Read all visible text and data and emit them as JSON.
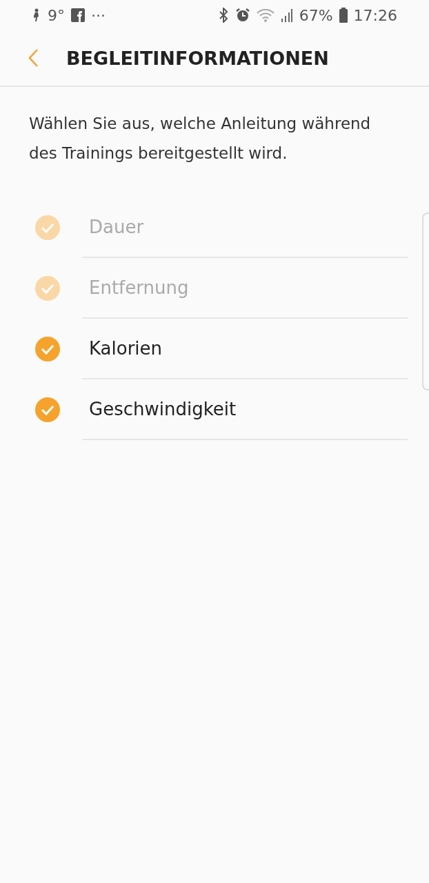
{
  "status_bar": {
    "temperature": "9°",
    "more": "···",
    "battery": "67%",
    "time": "17:26"
  },
  "header": {
    "title": "BEGLEITINFORMATIONEN"
  },
  "description": "Wählen Sie aus, welche Anleitung während des Trainings bereitgestellt wird.",
  "options": [
    {
      "label": "Dauer",
      "checked": true,
      "disabled": true
    },
    {
      "label": "Entfernung",
      "checked": true,
      "disabled": true
    },
    {
      "label": "Kalorien",
      "checked": true,
      "disabled": false
    },
    {
      "label": "Geschwindigkeit",
      "checked": true,
      "disabled": false
    }
  ]
}
